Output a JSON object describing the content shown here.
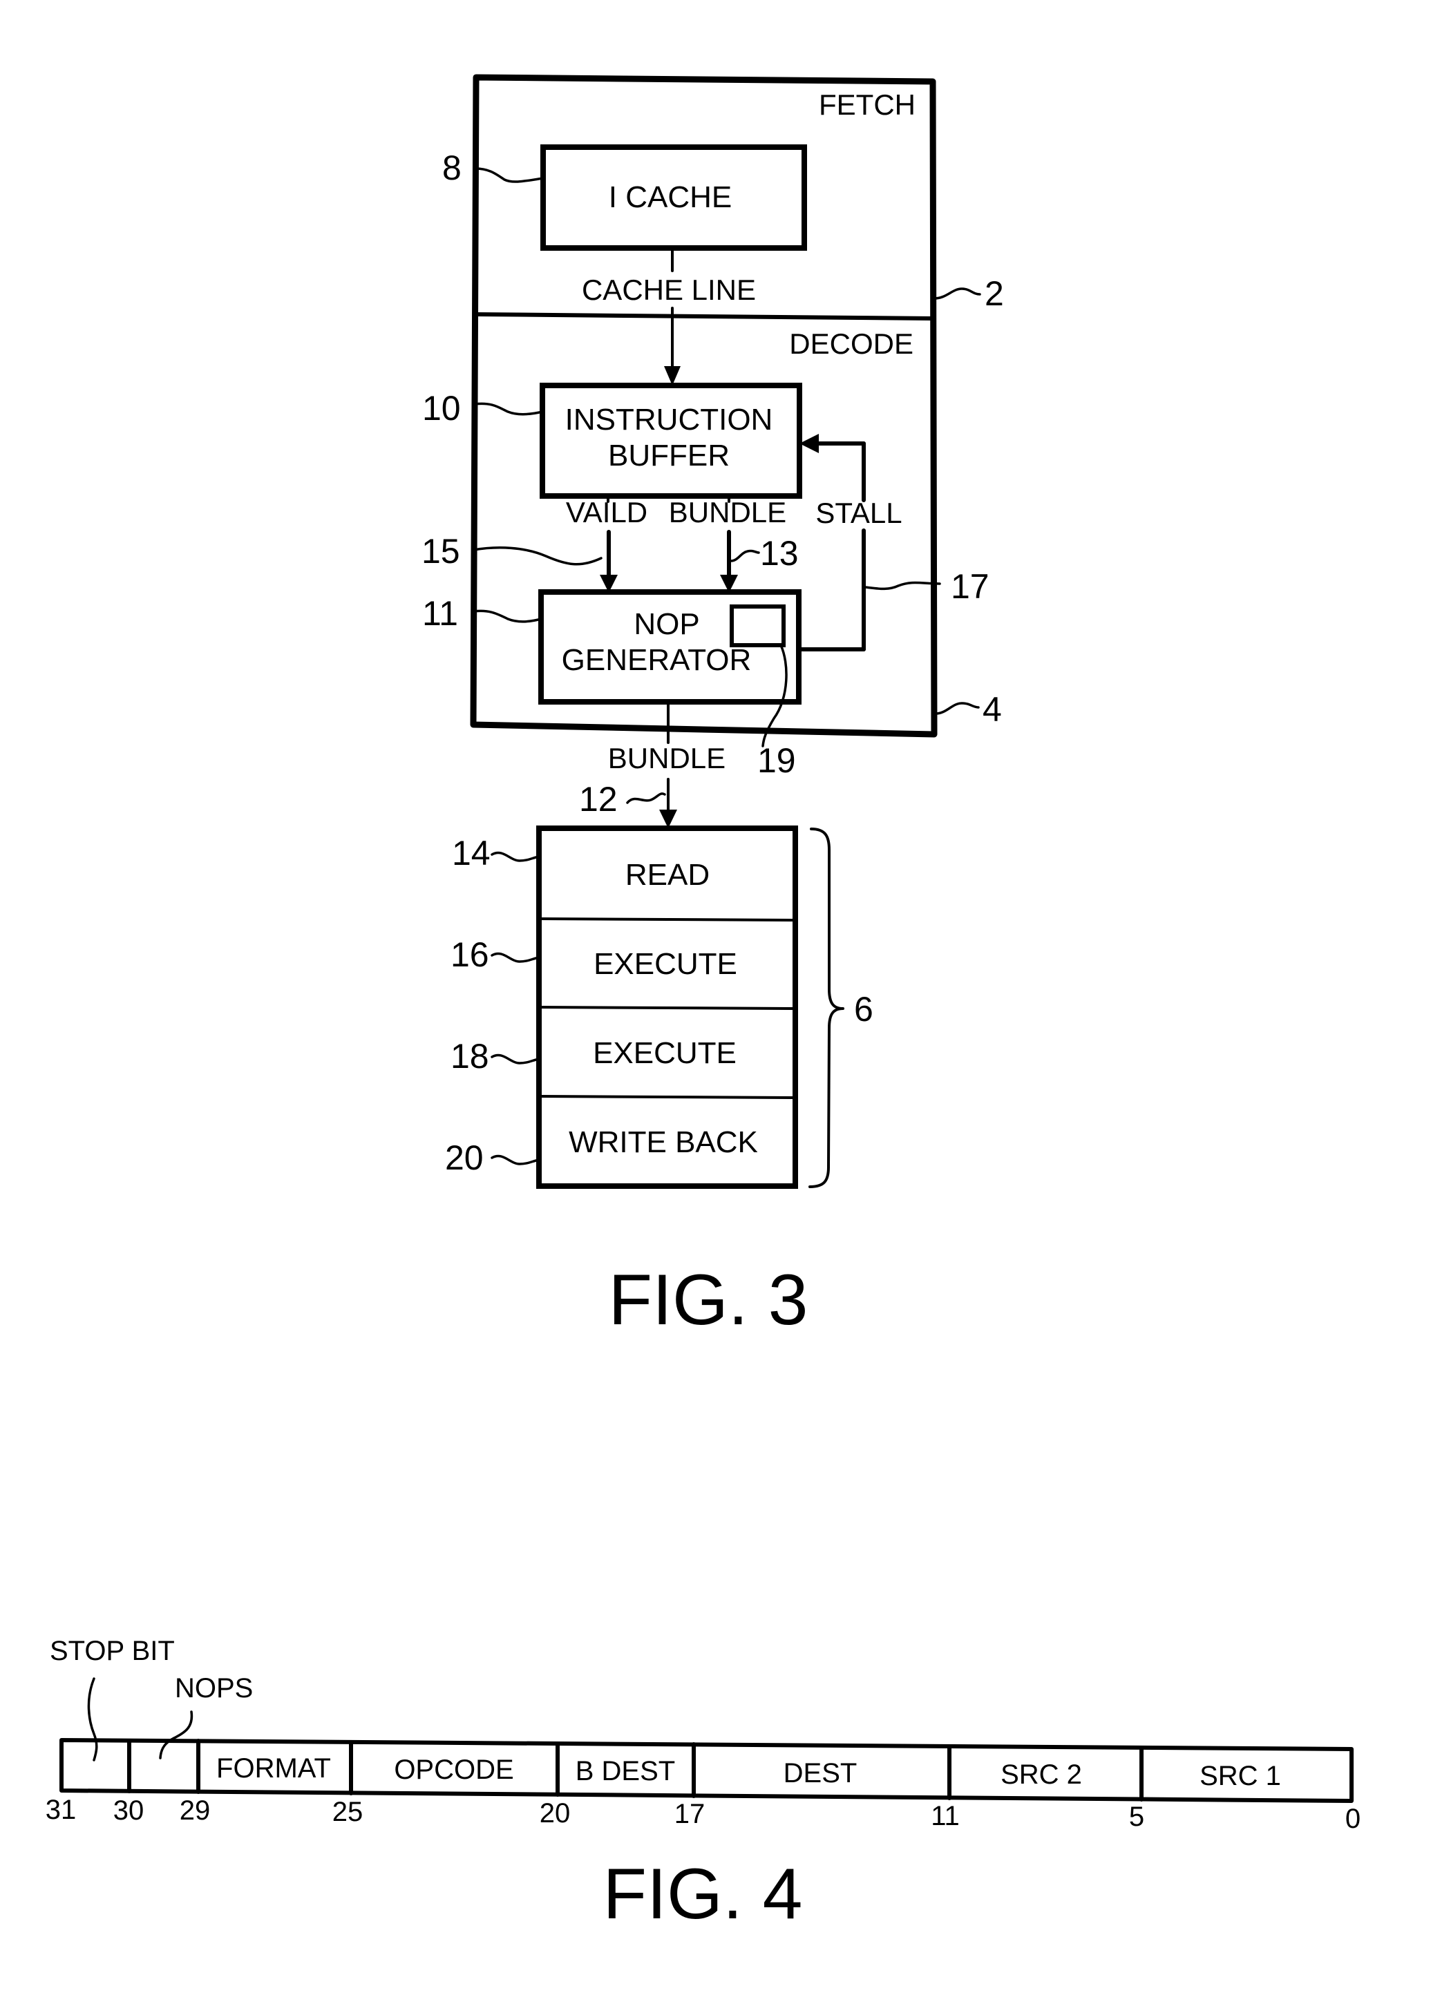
{
  "fig3": {
    "caption": "FIG. 3",
    "fetch_stage": {
      "label": "FETCH",
      "ref": "2"
    },
    "decode_stage": {
      "label": "DECODE",
      "ref": "4"
    },
    "icache": {
      "label": "I CACHE",
      "ref": "8"
    },
    "cache_line_label": "CACHE LINE",
    "instruction_buffer": {
      "line1": "INSTRUCTION",
      "line2": "BUFFER",
      "ref": "10"
    },
    "valid_label": "VAILD",
    "valid_ref": "15",
    "bundle_in_label": "BUNDLE",
    "bundle_in_ref": "13",
    "stall_label": "STALL",
    "stall_ref": "17",
    "nop_generator": {
      "line1": "NOP",
      "line2": "GENERATOR",
      "ref": "11",
      "inner_ref": "19"
    },
    "bundle_out_label": "BUNDLE",
    "bundle_out_ref": "12",
    "pipeline": {
      "ref": "6",
      "stages": [
        {
          "label": "READ",
          "ref": "14"
        },
        {
          "label": "EXECUTE",
          "ref": "16"
        },
        {
          "label": "EXECUTE",
          "ref": "18"
        },
        {
          "label": "WRITE BACK",
          "ref": "20"
        }
      ]
    }
  },
  "fig4": {
    "caption": "FIG. 4",
    "stop_bit_label": "STOP BIT",
    "nops_label": "NOPS",
    "fields": [
      {
        "label": "",
        "high_bit": "31"
      },
      {
        "label": "",
        "high_bit": "30"
      },
      {
        "label": "FORMAT",
        "high_bit": "29"
      },
      {
        "label": "OPCODE",
        "high_bit": "25"
      },
      {
        "label": "B DEST",
        "high_bit": "20"
      },
      {
        "label": "DEST",
        "high_bit": "17"
      },
      {
        "label": "SRC 2",
        "high_bit": "11"
      },
      {
        "label": "SRC 1",
        "high_bit": "5"
      }
    ],
    "low_bit": "0"
  }
}
